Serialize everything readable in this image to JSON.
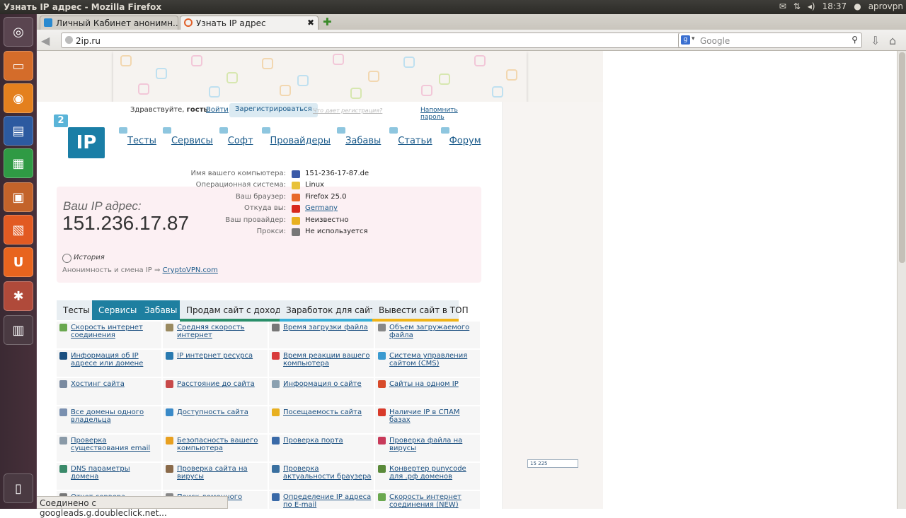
{
  "window": {
    "title": "Узнать IP адрес - Mozilla Firefox",
    "time": "18:37",
    "user": "aprovpn"
  },
  "tabs": [
    {
      "label": "Личный Кабинет анонимн...",
      "active": false
    },
    {
      "label": "Узнать IP адрес",
      "active": true
    }
  ],
  "url": "2ip.ru",
  "search_placeholder": "Google",
  "userbar": {
    "greeting": "Здравствуйте, ",
    "guest": "гость",
    "login": "Войти",
    "register": "Зарегистрироваться",
    "why": "Что дает регистрация?",
    "remind": "Напомнить пароль"
  },
  "logo": {
    "num": "2",
    "text": "IP"
  },
  "menu": [
    "Тесты",
    "Сервисы",
    "Софт",
    "Провайдеры",
    "Забавы",
    "Статьи",
    "Форум"
  ],
  "ip": {
    "label": "Ваш IP адрес:",
    "value": "151.236.17.87",
    "history": "История",
    "anon_text": "Анонимность и смена IP",
    "anon_link": "CryptoVPN.com"
  },
  "info": [
    {
      "k": "Имя вашего компьютера:",
      "v": "151-236-17-87.de",
      "color": "#3a5aa8",
      "link": false
    },
    {
      "k": "Операционная система:",
      "v": "Linux",
      "color": "#e8c23a",
      "link": false
    },
    {
      "k": "Ваш браузер:",
      "v": "Firefox 25.0",
      "color": "#e8692a",
      "link": false
    },
    {
      "k": "Откуда вы:",
      "v": "Germany",
      "color": "#d8281e",
      "link": true
    },
    {
      "k": "Ваш провайдер:",
      "v": "Неизвестно",
      "color": "#e8b020",
      "link": false
    },
    {
      "k": "Прокси:",
      "v": "Не используется",
      "color": "#777777",
      "link": false
    }
  ],
  "section_tabs": [
    {
      "label": "Тесты",
      "style": "plain",
      "color": "#dfe9f0"
    },
    {
      "label": "Сервисы",
      "style": "active",
      "color": "#1e7fa0"
    },
    {
      "label": "Забавы",
      "style": "active",
      "color": "#1e7fa0"
    },
    {
      "label": "Продам сайт с доходом",
      "style": "plain",
      "color": "#2a8f6a"
    },
    {
      "label": "Заработок для сайтов",
      "style": "plain",
      "color": "#3ab0d8"
    },
    {
      "label": "Вывести сайт в ТОП",
      "style": "plain",
      "color": "#f0b418"
    }
  ],
  "services": [
    [
      "Скорость интернет соединения",
      "Средняя скорость интернет",
      "Время загрузки файла",
      "Объем загружаемого файла"
    ],
    [
      "Информация об IP адресе или домене",
      "IP интернет ресурса",
      "Время реакции вашего компьютера",
      "Система управления сайтом (CMS)"
    ],
    [
      "Хостинг сайта",
      "Расстояние до сайта",
      "Информация о сайте",
      "Сайты на одном IP"
    ],
    [
      "Все домены одного владельца",
      "Доступность сайта",
      "Посещаемость сайта",
      "Наличие IP в СПАМ базах"
    ],
    [
      "Проверка существования email",
      "Безопасность вашего компьютера",
      "Проверка порта",
      "Проверка файла на вирусы"
    ],
    [
      "DNS параметры домена",
      "Проверка сайта на вирусы",
      "Проверка актуальности браузера",
      "Конвертер punycode для .рф доменов"
    ],
    [
      "Отчет сервера",
      "Поиск доменного имени",
      "Определение IP адреса по E-mail",
      "Скорость интернет соединения (NEW)"
    ]
  ],
  "status": "Соединено с googleads.g.doubleclick.net...",
  "counter": "15 225"
}
